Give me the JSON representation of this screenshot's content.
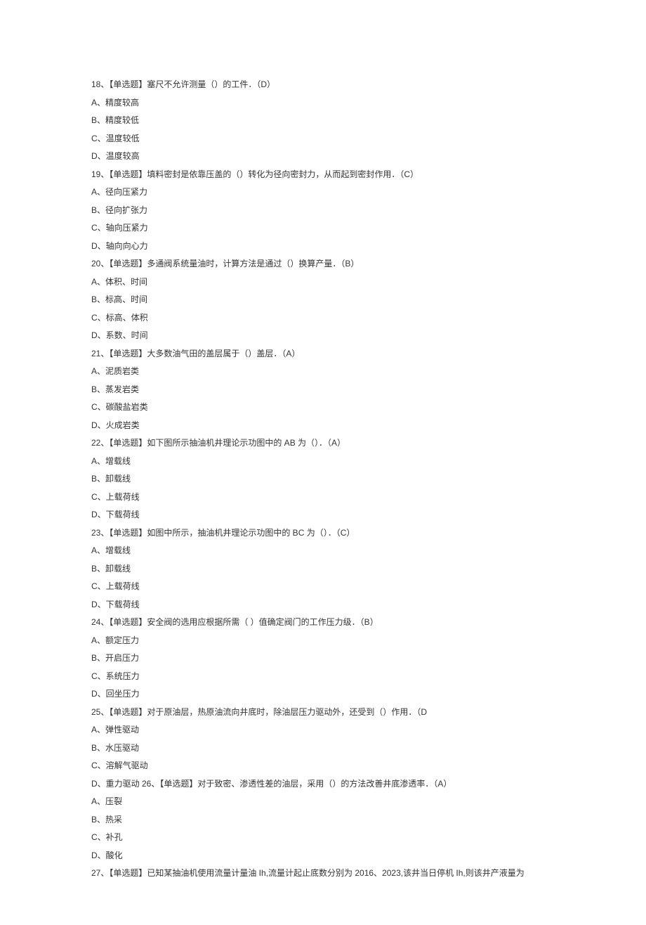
{
  "lines": [
    "18、【单选题】塞尺不允许测量（）的工件．（D）",
    "A、精度较高",
    "B、精度较低",
    "C、温度较低",
    "D、温度较高",
    "19、【单选题】填料密封是依靠压盖的（）转化为径向密封力，从而起到密封作用．（C）",
    "A、径向压紧力",
    "B、径向扩张力",
    "C、轴向压紧力",
    "D、轴向向心力",
    "20、【单选题】多通阀系统量油时，计算方法是通过（）换算产量．（B）",
    "A、体积、时间",
    "B、标高、时间",
    "C、标高、体积",
    "D、系数、时间",
    "21、【单选题】大多数油气田的盖层属于（）盖层．（A）",
    "A、泥质岩类",
    "B、蒸发岩类",
    "C、碳酸盐岩类",
    "D、火成岩类",
    "22、【单选题】如下图所示抽油机井理论示功图中的 AB 为（）．（A）",
    "A、增载线",
    "B、卸载线",
    "C、上载荷线",
    "D、下载荷线",
    "23、【单选题】如图中所示，抽油机井理论示功图中的 BC 为（）．（C）",
    "A、增载线",
    "B、卸载线",
    "C、上载荷线",
    "D、下载荷线",
    "24、【单选题】安全阀的选用应根据所需（ ）值确定阀门的工作压力级．（B）",
    "A、额定压力",
    "B、开启压力",
    "C、系统压力",
    "D、回坐压力",
    "25、【单选题】对于原油层，热原油流向井底时，除油层压力驱动外，还受到（）作用．（D",
    "A、弹性驱动",
    "B、水压驱动",
    "C、溶解气驱动",
    "D、重力驱动 26、【单选题】对于致密、渗透性差的油层，采用（）的方法改善井底渗透率．（A）",
    "A、压裂",
    "B、热采",
    "C、补孔",
    "D、酸化",
    "27、【单选题】已知某抽油机使用流量计量油 Ih,流量计起止底数分别为 2016、2023,该井当日停机 Ih,则该井产液量为"
  ]
}
